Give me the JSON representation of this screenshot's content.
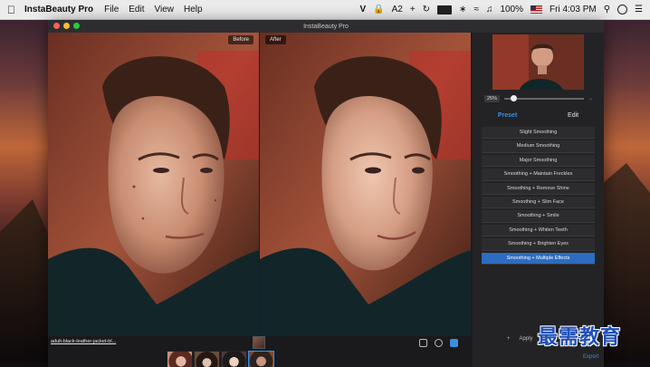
{
  "menubar": {
    "apple_icon": "apple-icon",
    "app_name": "InstaBeauty Pro",
    "menus": [
      "File",
      "Edit",
      "View",
      "Help"
    ],
    "tray": {
      "tray1": "V",
      "tray2": "A",
      "tray3": "2",
      "battery": "100%",
      "clock": "Fri 4:03 PM"
    }
  },
  "window": {
    "title": "InstaBeauty Pro",
    "before_label": "Before",
    "after_label": "After",
    "filename": "adult-black-leather-jacket-bl...",
    "sidebar": {
      "zoom": "25%",
      "zoom_level": 0.08,
      "tabs": {
        "preset": "Preset",
        "edit": "Edit"
      },
      "presets": [
        "Slight Smoothing",
        "Medium Smoothing",
        "Major Smoothing",
        "Smoothing + Maintain Freckles",
        "Smoothing + Remove Shine",
        "Smoothing + Slim Face",
        "Smoothing + Smile",
        "Smoothing + Whiten Teeth",
        "Smoothing + Brighten Eyes",
        "Smoothing + Multiple Effects"
      ],
      "selected_preset": "Smoothing + Multiple Effects",
      "apply_label": "Apply",
      "export_label": "Export"
    }
  },
  "watermark": "最需教育",
  "colors": {
    "accent": "#3a8fe0",
    "selected": "#2d6cc0",
    "window_bg": "#1c1c1e"
  }
}
